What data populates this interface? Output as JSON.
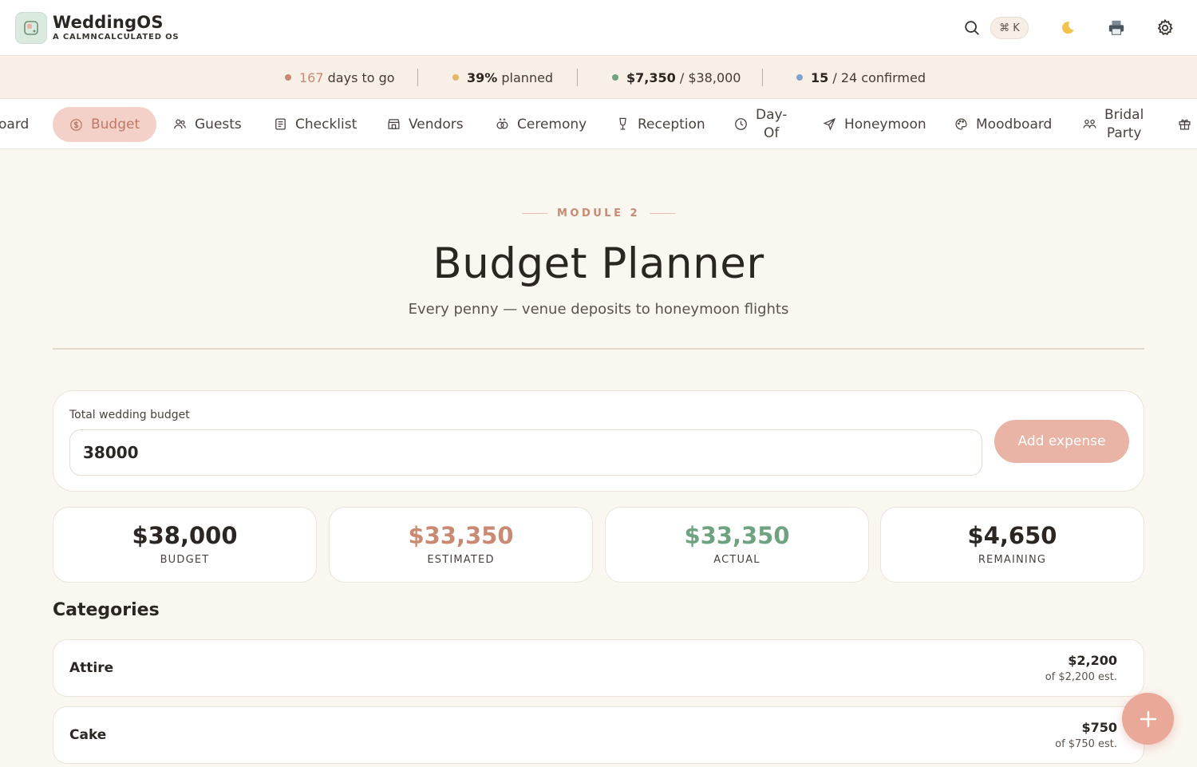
{
  "app": {
    "name": "WeddingOS",
    "tagline": "A CALMNCALCULATED OS",
    "shortcut": "⌘ K"
  },
  "colors": {
    "accent": "#e9a898",
    "accent_text": "#c27766",
    "estimated": "#c98a73",
    "actual": "#6fa37f",
    "dot_days": "#c98a73",
    "dot_planned": "#e3b768",
    "dot_money": "#6fa37f",
    "dot_guests": "#7fa3cf"
  },
  "status": {
    "days_value": "167",
    "days_label": "days to go",
    "planned_value": "39%",
    "planned_label": "planned",
    "spent_value": "$7,350",
    "spent_total": "/ $38,000",
    "confirmed_value": "15",
    "confirmed_total": "/ 24 confirmed"
  },
  "nav": {
    "items": [
      {
        "label": "oard",
        "icon": "dashboard-icon"
      },
      {
        "label": "Budget",
        "icon": "dollar-icon",
        "active": true
      },
      {
        "label": "Guests",
        "icon": "users-icon"
      },
      {
        "label": "Checklist",
        "icon": "checklist-icon"
      },
      {
        "label": "Vendors",
        "icon": "store-icon"
      },
      {
        "label": "Ceremony",
        "icon": "rings-icon"
      },
      {
        "label": "Reception",
        "icon": "glass-icon"
      },
      {
        "label_line1": "Day-",
        "label_line2": "Of",
        "icon": "clock-icon"
      },
      {
        "label": "Honeymoon",
        "icon": "plane-icon"
      },
      {
        "label": "Moodboard",
        "icon": "palette-icon"
      },
      {
        "label_line1": "Bridal",
        "label_line2": "Party",
        "icon": "group-icon"
      },
      {
        "label": "",
        "icon": "gift-icon"
      }
    ]
  },
  "page": {
    "module": "MODULE 2",
    "title": "Budget Planner",
    "subtitle": "Every penny — venue deposits to honeymoon flights"
  },
  "budget_form": {
    "label": "Total wedding budget",
    "value": "38000",
    "add_label": "Add expense"
  },
  "kpis": [
    {
      "value": "$38,000",
      "caption": "BUDGET"
    },
    {
      "value": "$33,350",
      "caption": "ESTIMATED"
    },
    {
      "value": "$33,350",
      "caption": "ACTUAL"
    },
    {
      "value": "$4,650",
      "caption": "REMAINING"
    }
  ],
  "categories": {
    "heading": "Categories",
    "rows": [
      {
        "name": "Attire",
        "amount": "$2,200",
        "estimate": "of $2,200 est."
      },
      {
        "name": "Cake",
        "amount": "$750",
        "estimate": "of $750 est."
      }
    ]
  }
}
